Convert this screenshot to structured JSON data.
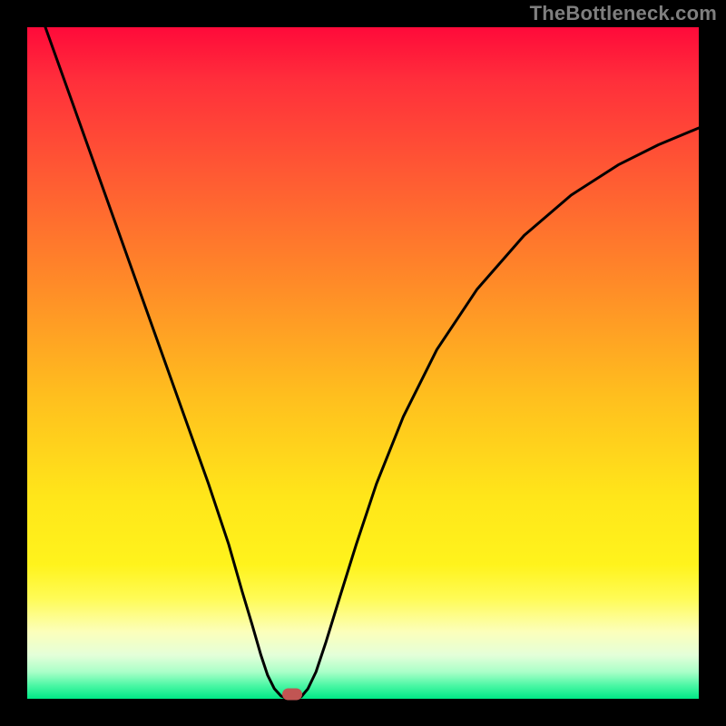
{
  "watermark": "TheBottleneck.com",
  "chart_data": {
    "type": "line",
    "title": "",
    "xlabel": "",
    "ylabel": "",
    "xlim": [
      0,
      1
    ],
    "ylim": [
      0,
      1
    ],
    "grid": false,
    "legend": false,
    "colors": {
      "top": "#ff0a3a",
      "mid_upper": "#ff8a28",
      "mid": "#ffe61a",
      "mid_lower": "#fcffba",
      "bottom": "#00e886",
      "curve": "#000000",
      "marker": "#c15553",
      "frame": "#000000",
      "watermark": "#7f7f7f"
    },
    "series": [
      {
        "name": "curve",
        "points": [
          {
            "x": 0.027,
            "y": 1.0
          },
          {
            "x": 0.07,
            "y": 0.88
          },
          {
            "x": 0.12,
            "y": 0.74
          },
          {
            "x": 0.17,
            "y": 0.6
          },
          {
            "x": 0.22,
            "y": 0.46
          },
          {
            "x": 0.27,
            "y": 0.32
          },
          {
            "x": 0.3,
            "y": 0.23
          },
          {
            "x": 0.32,
            "y": 0.16
          },
          {
            "x": 0.335,
            "y": 0.11
          },
          {
            "x": 0.348,
            "y": 0.065
          },
          {
            "x": 0.358,
            "y": 0.035
          },
          {
            "x": 0.368,
            "y": 0.015
          },
          {
            "x": 0.378,
            "y": 0.004
          },
          {
            "x": 0.388,
            "y": 0.0
          },
          {
            "x": 0.398,
            "y": 0.0
          },
          {
            "x": 0.408,
            "y": 0.003
          },
          {
            "x": 0.418,
            "y": 0.015
          },
          {
            "x": 0.43,
            "y": 0.04
          },
          {
            "x": 0.445,
            "y": 0.085
          },
          {
            "x": 0.465,
            "y": 0.15
          },
          {
            "x": 0.49,
            "y": 0.23
          },
          {
            "x": 0.52,
            "y": 0.32
          },
          {
            "x": 0.56,
            "y": 0.42
          },
          {
            "x": 0.61,
            "y": 0.52
          },
          {
            "x": 0.67,
            "y": 0.61
          },
          {
            "x": 0.74,
            "y": 0.69
          },
          {
            "x": 0.81,
            "y": 0.75
          },
          {
            "x": 0.88,
            "y": 0.795
          },
          {
            "x": 0.94,
            "y": 0.825
          },
          {
            "x": 1.0,
            "y": 0.85
          }
        ]
      }
    ],
    "marker": {
      "x": 0.395,
      "y": 0.007
    }
  }
}
